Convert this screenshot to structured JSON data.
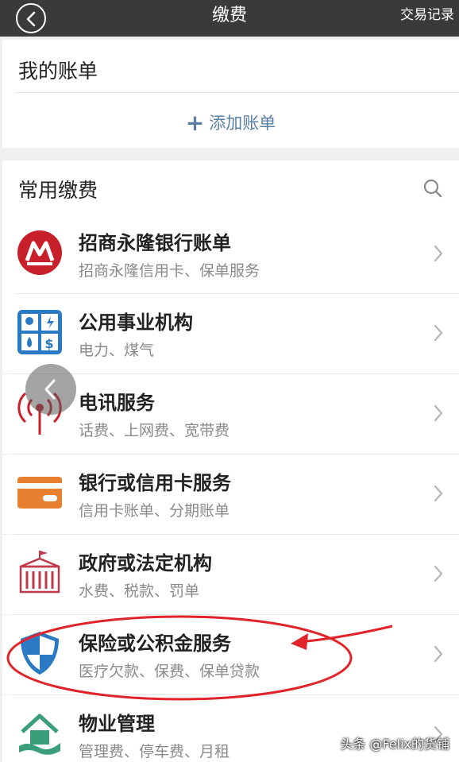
{
  "header": {
    "title": "缴费",
    "right_link": "交易记录"
  },
  "my_bills": {
    "title": "我的账单",
    "add_label": "添加账单"
  },
  "common": {
    "title": "常用缴费",
    "items": [
      {
        "name": "招商永隆银行账单",
        "sub": "招商永隆信用卡、保单服务",
        "icon": "cmb-logo-icon"
      },
      {
        "name": "公用事业机构",
        "sub": "电力、煤气",
        "icon": "utilities-icon"
      },
      {
        "name": "电讯服务",
        "sub": "话费、上网费、宽带费",
        "icon": "telecom-icon"
      },
      {
        "name": "银行或信用卡服务",
        "sub": "信用卡账单、分期账单",
        "icon": "credit-card-icon"
      },
      {
        "name": "政府或法定机构",
        "sub": "水费、税款、罚单",
        "icon": "government-icon"
      },
      {
        "name": "保险或公积金服务",
        "sub": "医疗欠款、保费、保单贷款",
        "icon": "shield-icon"
      },
      {
        "name": "物业管理",
        "sub": "管理费、停车费、月租",
        "icon": "property-icon"
      }
    ]
  },
  "watermark": "头条 @Felix的货铺",
  "colors": {
    "topbar": "#3a3a3a",
    "accent": "#5a7fa3",
    "annotation": "#e0242a"
  }
}
